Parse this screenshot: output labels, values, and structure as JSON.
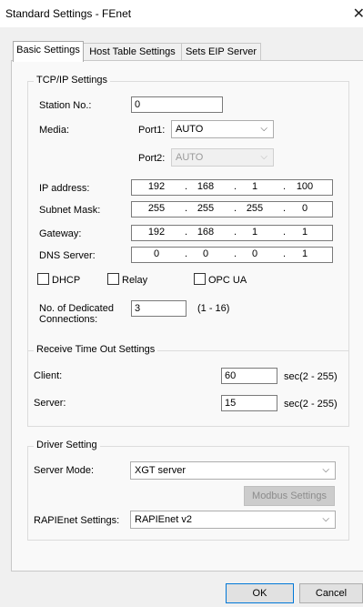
{
  "window": {
    "title": "Standard Settings - FEnet"
  },
  "tabs": [
    "Basic Settings",
    "Host Table Settings",
    "Sets EIP Server"
  ],
  "tcpip": {
    "title": "TCP/IP Settings",
    "station_label": "Station No.:",
    "station_value": "0",
    "media_label": "Media:",
    "port1_label": "Port1:",
    "port1_value": "AUTO",
    "port2_label": "Port2:",
    "port2_value": "AUTO",
    "ip_label": "IP address:",
    "ip": [
      "192",
      "168",
      "1",
      "100"
    ],
    "subnet_label": "Subnet Mask:",
    "subnet": [
      "255",
      "255",
      "255",
      "0"
    ],
    "gateway_label": "Gateway:",
    "gateway": [
      "192",
      "168",
      "1",
      "1"
    ],
    "dns_label": "DNS Server:",
    "dns": [
      "0",
      "0",
      "0",
      "1"
    ],
    "dhcp_label": "DHCP",
    "relay_label": "Relay",
    "opcua_label": "OPC UA",
    "conn_label_1": "No. of Dedicated",
    "conn_label_2": "Connections:",
    "conn_value": "3",
    "conn_range": "(1 - 16)"
  },
  "timeout": {
    "title": "Receive Time Out Settings",
    "client_label": "Client:",
    "client_value": "60",
    "client_unit": "sec(2 - 255)",
    "server_label": "Server:",
    "server_value": "15",
    "server_unit": "sec(2 - 255)"
  },
  "driver": {
    "title": "Driver Setting",
    "mode_label": "Server Mode:",
    "mode_value": "XGT server",
    "modbus_button": "Modbus Settings",
    "rapi_label": "RAPIEnet Settings:",
    "rapi_value": "RAPIEnet v2"
  },
  "footer": {
    "ok": "OK",
    "cancel": "Cancel"
  }
}
